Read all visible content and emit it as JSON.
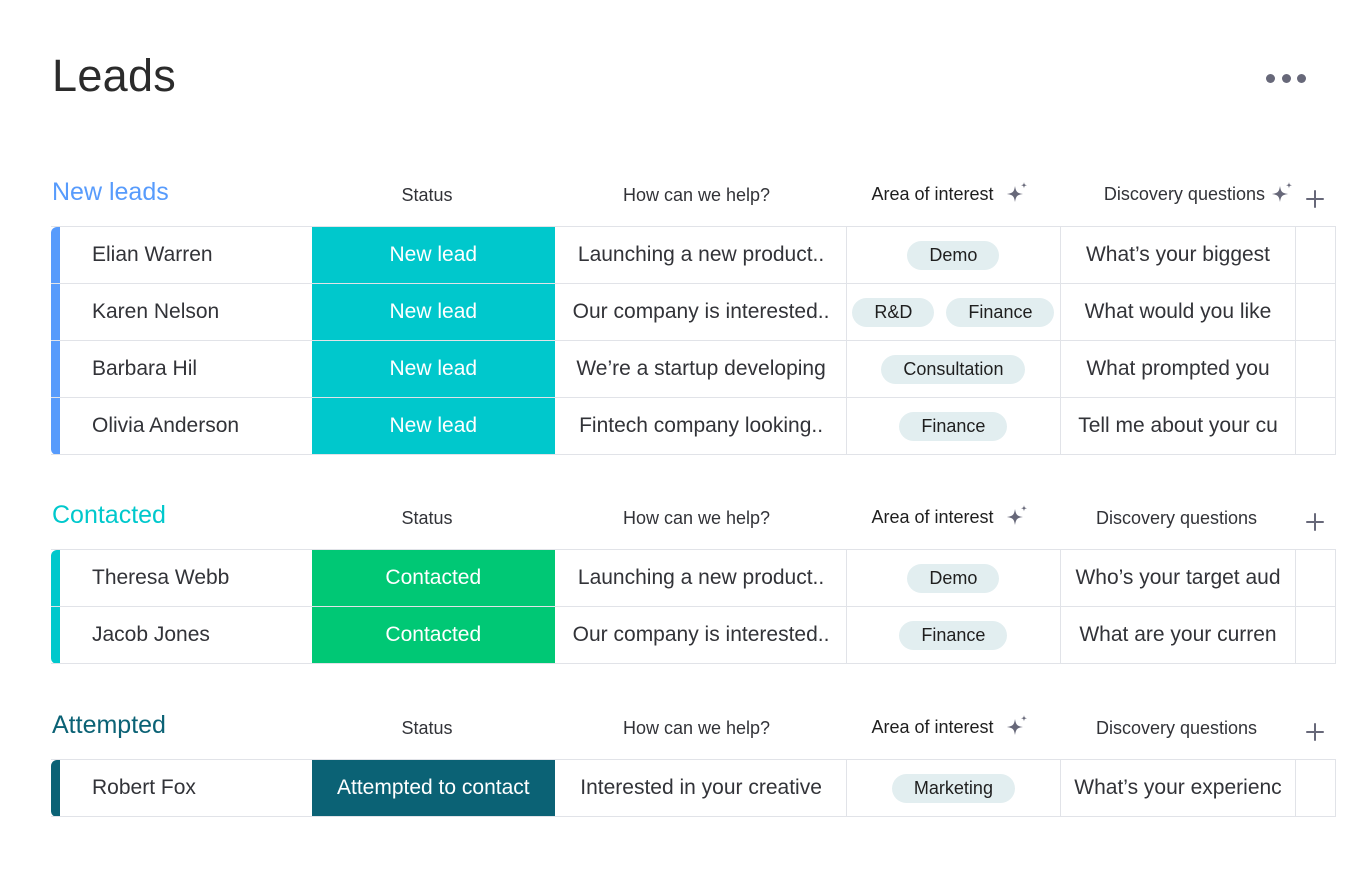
{
  "page": {
    "title": "Leads",
    "more_icon": "more-horizontal-icon"
  },
  "columns": {
    "status": "Status",
    "help": "How can we help?",
    "area": "Area of interest",
    "discovery": "Discovery questions"
  },
  "groups": [
    {
      "title": "New leads",
      "color": "#579bfc",
      "discovery_has_ai_icon": true,
      "rows": [
        {
          "name": "Elian Warren",
          "status": "New lead",
          "status_color": "#00c8cc",
          "help": "Launching a new product..",
          "tags": [
            "Demo"
          ],
          "discovery": "What’s your biggest"
        },
        {
          "name": "Karen Nelson",
          "status": "New lead",
          "status_color": "#00c8cc",
          "help": "Our company is interested..",
          "tags": [
            "R&D",
            "Finance"
          ],
          "discovery": "What would you like"
        },
        {
          "name": "Barbara Hil",
          "status": "New lead",
          "status_color": "#00c8cc",
          "help": "We’re a startup developing",
          "tags": [
            "Consultation"
          ],
          "discovery": "What prompted you"
        },
        {
          "name": "Olivia Anderson",
          "status": "New lead",
          "status_color": "#00c8cc",
          "help": "Fintech company looking..",
          "tags": [
            "Finance"
          ],
          "discovery": "Tell me about your cu"
        }
      ]
    },
    {
      "title": "Contacted",
      "color": "#00c8cc",
      "discovery_has_ai_icon": false,
      "rows": [
        {
          "name": "Theresa Webb",
          "status": "Contacted",
          "status_color": "#00c875",
          "help": "Launching a new product..",
          "tags": [
            "Demo"
          ],
          "discovery": "Who’s your target aud"
        },
        {
          "name": "Jacob Jones",
          "status": "Contacted",
          "status_color": "#00c875",
          "help": "Our company is interested..",
          "tags": [
            "Finance"
          ],
          "discovery": "What are your curren"
        }
      ]
    },
    {
      "title": "Attempted",
      "color": "#0b6275",
      "discovery_has_ai_icon": false,
      "rows": [
        {
          "name": "Robert Fox",
          "status": "Attempted to contact",
          "status_color": "#0b6275",
          "help": "Interested in your creative",
          "tags": [
            "Marketing"
          ],
          "discovery": "What’s your experienc"
        }
      ]
    }
  ]
}
